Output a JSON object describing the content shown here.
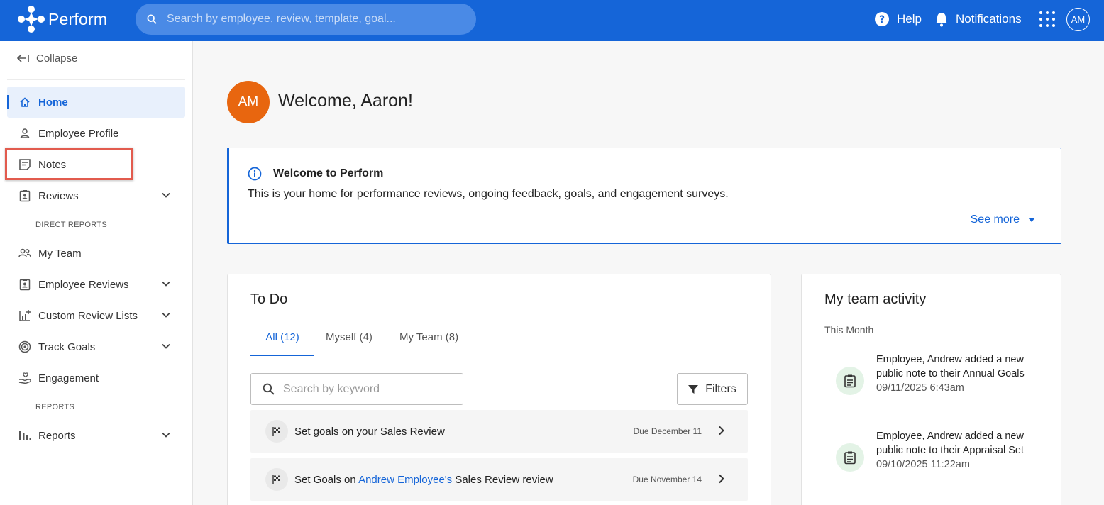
{
  "app": {
    "name": "Perform"
  },
  "header": {
    "search_placeholder": "Search by employee, review, template, goal...",
    "help_label": "Help",
    "notifications_label": "Notifications",
    "user_initials": "AM"
  },
  "sidebar": {
    "collapse_label": "Collapse",
    "items": [
      {
        "label": "Home",
        "icon": "home-icon",
        "active": true
      },
      {
        "label": "Employee Profile",
        "icon": "person-icon"
      },
      {
        "label": "Notes",
        "icon": "notes-icon"
      },
      {
        "label": "Reviews",
        "icon": "clipboard-icon",
        "expandable": true
      }
    ],
    "direct_reports_label": "DIRECT REPORTS",
    "direct_items": [
      {
        "label": "My Team",
        "icon": "team-icon"
      },
      {
        "label": "Employee Reviews",
        "icon": "clipboard-icon",
        "expandable": true
      },
      {
        "label": "Custom Review Lists",
        "icon": "chart-add-icon",
        "expandable": true
      },
      {
        "label": "Track Goals",
        "icon": "target-icon",
        "expandable": true
      },
      {
        "label": "Engagement",
        "icon": "hand-heart-icon"
      }
    ],
    "reports_label": "REPORTS",
    "report_items": [
      {
        "label": "Reports",
        "icon": "bar-chart-icon",
        "expandable": true
      }
    ]
  },
  "main": {
    "avatar_initials": "AM",
    "welcome_title": "Welcome, Aaron!",
    "info": {
      "title": "Welcome to Perform",
      "body": "This is your home for performance reviews, ongoing feedback, goals, and engagement surveys.",
      "see_more": "See more"
    },
    "todo": {
      "title": "To Do",
      "tabs": [
        {
          "label": "All (12)",
          "active": true
        },
        {
          "label": "Myself (4)"
        },
        {
          "label": "My Team (8)"
        }
      ],
      "search_placeholder": "Search by keyword",
      "filters_label": "Filters",
      "tasks": [
        {
          "prefix": "Set goals on your Sales Review",
          "link": "",
          "suffix": "",
          "due": "Due December 11"
        },
        {
          "prefix": "Set Goals on ",
          "link": "Andrew Employee's",
          "suffix": " Sales Review review",
          "due": "Due November 14"
        }
      ]
    },
    "activity": {
      "title": "My team activity",
      "period": "This Month",
      "items": [
        {
          "text": "Employee, Andrew added a new public note to their Annual Goals",
          "time": "09/11/2025 6:43am"
        },
        {
          "text": "Employee, Andrew added a new public note to their Appraisal Set",
          "time": "09/10/2025 11:22am"
        }
      ]
    }
  },
  "colors": {
    "brand": "#1565d8",
    "avatar": "#e8660f",
    "highlight": "#e25b4e"
  }
}
